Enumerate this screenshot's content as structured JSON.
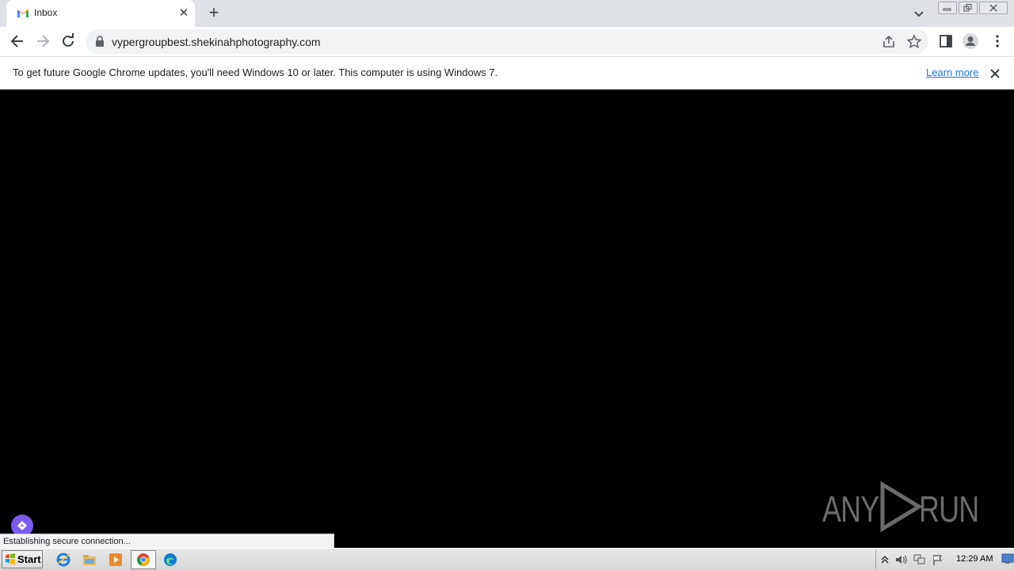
{
  "browser": {
    "tab": {
      "title": "Inbox"
    },
    "omnibox": {
      "url_host": "vypergroupbest.",
      "url_domain": "shekinahphotography.com"
    },
    "infobar": {
      "message": "To get future Google Chrome updates, you'll need Windows 10 or later. This computer is using Windows 7.",
      "link": "Learn more"
    },
    "status": "Establishing secure connection..."
  },
  "watermark": {
    "left": "ANY",
    "right": "RUN"
  },
  "taskbar": {
    "start_label": "Start",
    "clock": "12:29 AM",
    "apps": [
      "internet-explorer-icon",
      "file-explorer-icon",
      "media-player-icon",
      "chrome-icon",
      "edge-icon"
    ]
  },
  "colors": {
    "accent": "#1a73e8",
    "content_bg": "#000000",
    "purple_fab": "#7b5cf0"
  }
}
